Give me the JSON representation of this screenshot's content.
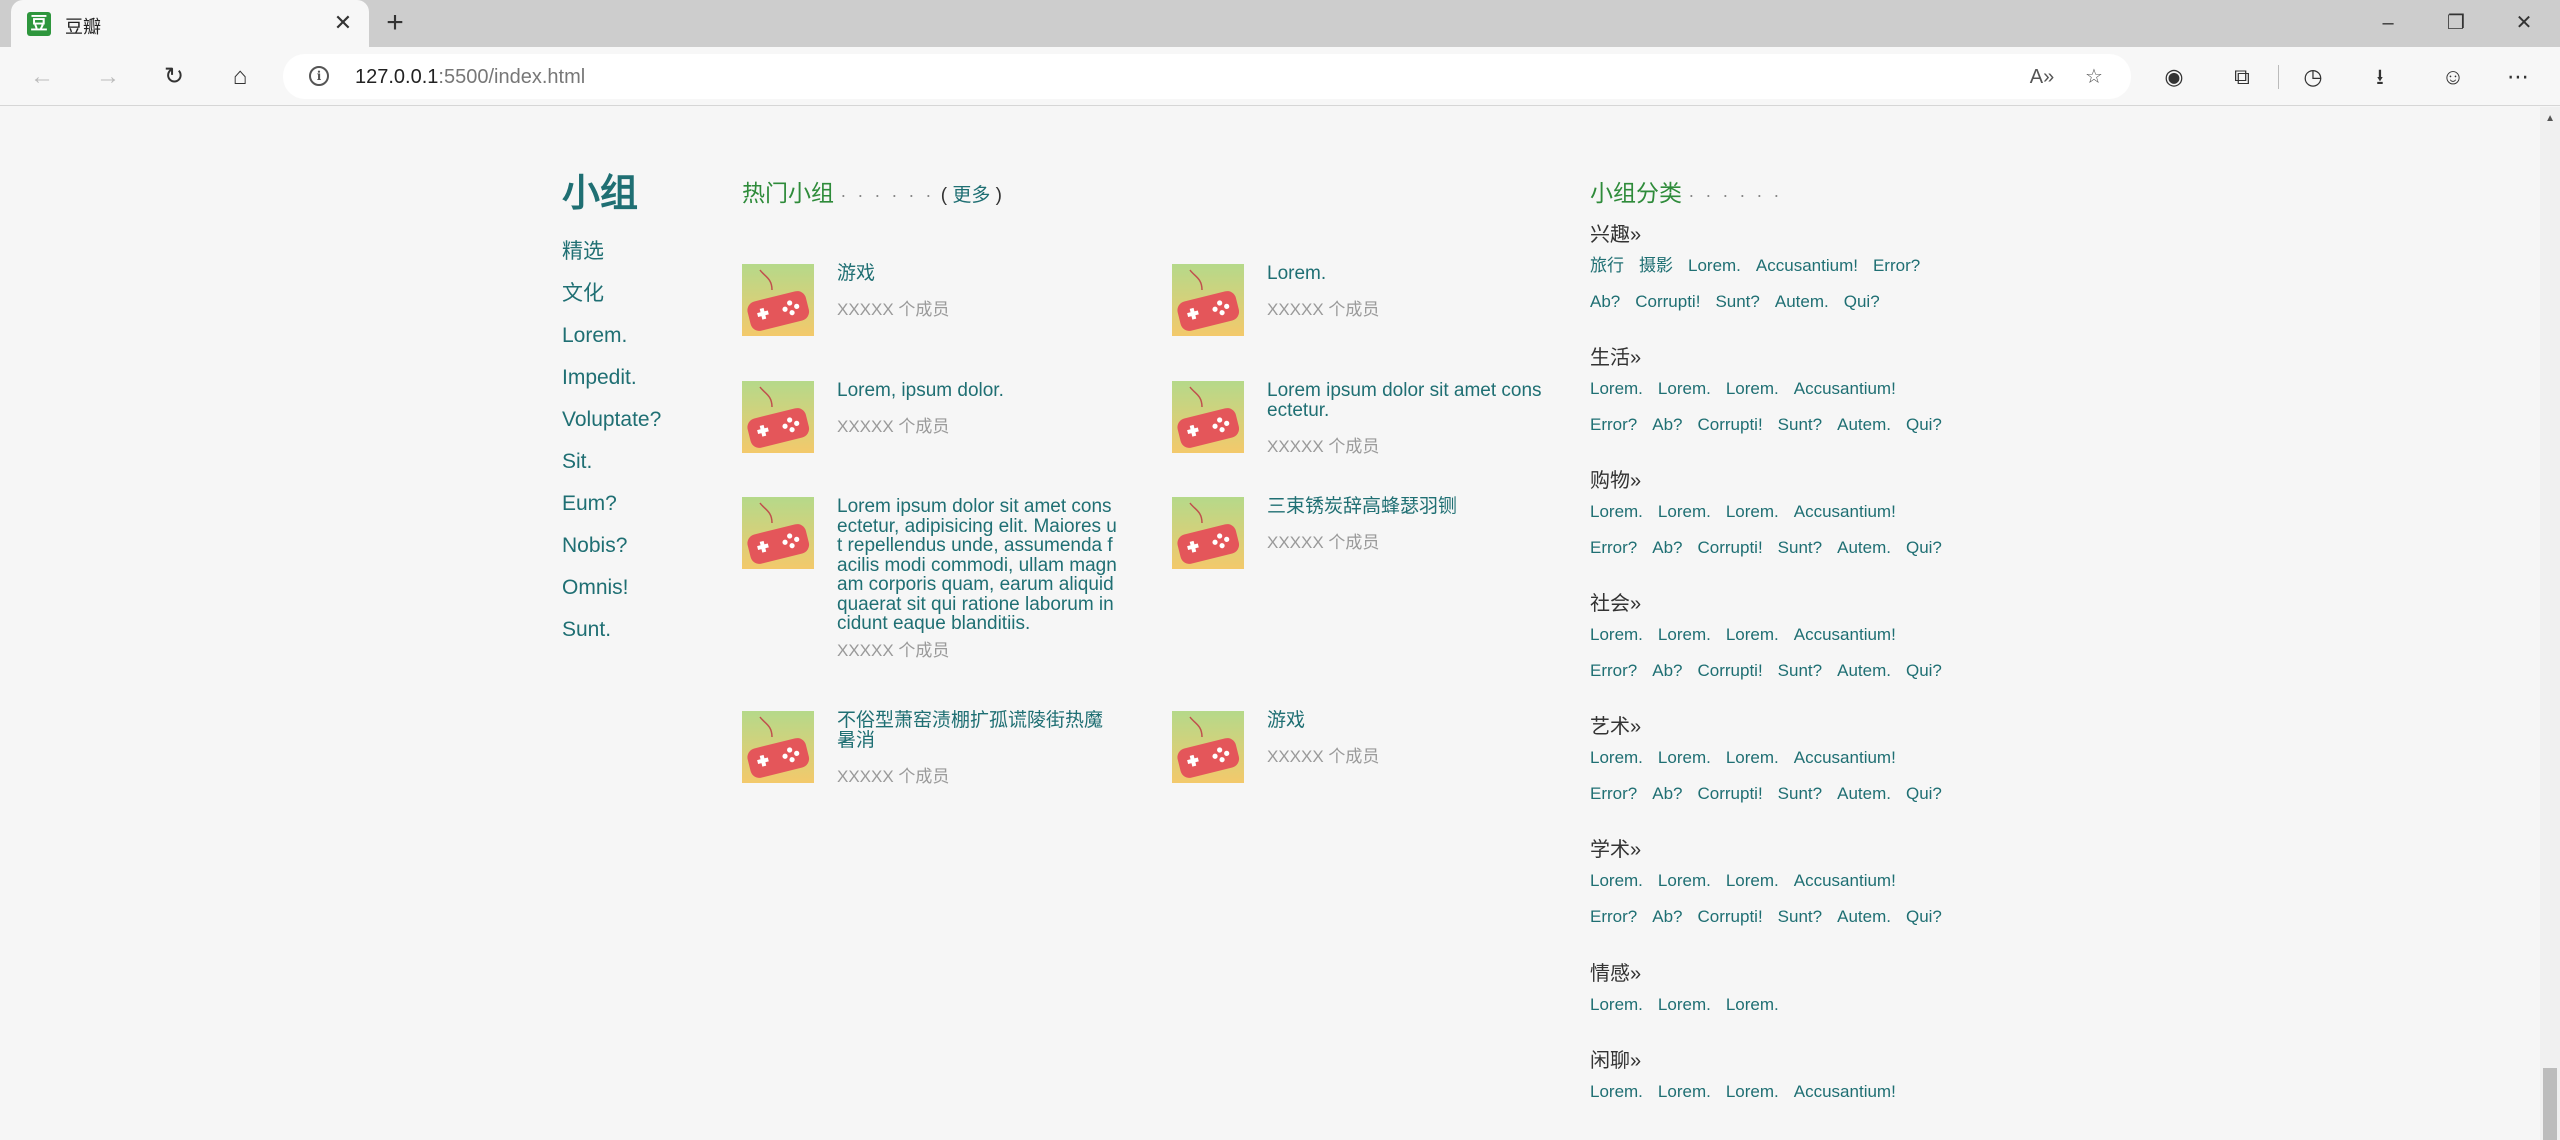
{
  "browser": {
    "tab_title": "豆瓣",
    "tab_icon": "douban-favicon",
    "favicon_char": "豆",
    "url_host": "127.0.0.1",
    "url_rest": ":5500/index.html"
  },
  "sidebar": {
    "title": "小组",
    "items": [
      "精选",
      "文化",
      "Lorem.",
      "Impedit.",
      "Voluptate?",
      "Sit.",
      "Eum?",
      "Nobis?",
      "Omnis!",
      "Sunt."
    ]
  },
  "hot": {
    "title": "热门小组",
    "dots": "· · · · · ·",
    "more_open": "(",
    "more_label": "更多",
    "more_close": ")",
    "groups": [
      {
        "name": "游戏",
        "members": "XXXXX 个成员"
      },
      {
        "name": "Lorem.",
        "members": "XXXXX 个成员"
      },
      {
        "name": "Lorem, ipsum dolor.",
        "members": "XXXXX 个成员"
      },
      {
        "name": "Lorem ipsum dolor sit amet consectetur.",
        "members": "XXXXX 个成员"
      },
      {
        "name": "Lorem ipsum dolor sit amet consectetur, adipisicing elit. Maiores ut repellendus unde, assumenda facilis modi commodi, ullam magnam corporis quam, earum aliquid quaerat sit qui ratione laborum incidunt eaque blanditiis.",
        "members": "XXXXX 个成员"
      },
      {
        "name": "三束锈炭辞高蜂瑟羽铡",
        "members": "XXXXX 个成员"
      },
      {
        "name": "不俗型萧窑渍棚扩孤谎陵街热魔暑消",
        "members": "XXXXX 个成员"
      },
      {
        "name": "游戏",
        "members": "XXXXX 个成员"
      }
    ]
  },
  "categories": {
    "title": "小组分类",
    "dots": "· · · · · ·",
    "blocks": [
      {
        "name": "兴趣»",
        "rows": [
          [
            "旅行",
            "摄影",
            "Lorem.",
            "Accusantium!",
            "Error?"
          ],
          [
            "Ab?",
            "Corrupti!",
            "Sunt?",
            "Autem.",
            "Qui?"
          ]
        ]
      },
      {
        "name": "生活»",
        "rows": [
          [
            "Lorem.",
            "Lorem.",
            "Lorem.",
            "Accusantium!"
          ],
          [
            "Error?",
            "Ab?",
            "Corrupti!",
            "Sunt?",
            "Autem.",
            "Qui?"
          ]
        ]
      },
      {
        "name": "购物»",
        "rows": [
          [
            "Lorem.",
            "Lorem.",
            "Lorem.",
            "Accusantium!"
          ],
          [
            "Error?",
            "Ab?",
            "Corrupti!",
            "Sunt?",
            "Autem.",
            "Qui?"
          ]
        ]
      },
      {
        "name": "社会»",
        "rows": [
          [
            "Lorem.",
            "Lorem.",
            "Lorem.",
            "Accusantium!"
          ],
          [
            "Error?",
            "Ab?",
            "Corrupti!",
            "Sunt?",
            "Autem.",
            "Qui?"
          ]
        ]
      },
      {
        "name": "艺术»",
        "rows": [
          [
            "Lorem.",
            "Lorem.",
            "Lorem.",
            "Accusantium!"
          ],
          [
            "Error?",
            "Ab?",
            "Corrupti!",
            "Sunt?",
            "Autem.",
            "Qui?"
          ]
        ]
      },
      {
        "name": "学术»",
        "rows": [
          [
            "Lorem.",
            "Lorem.",
            "Lorem.",
            "Accusantium!"
          ],
          [
            "Error?",
            "Ab?",
            "Corrupti!",
            "Sunt?",
            "Autem.",
            "Qui?"
          ]
        ]
      },
      {
        "name": "情感»",
        "rows": [
          [
            "Lorem.",
            "Lorem.",
            "Lorem."
          ]
        ]
      },
      {
        "name": "闲聊»",
        "rows": [
          [
            "Lorem.",
            "Lorem.",
            "Lorem.",
            "Accusantium!"
          ]
        ]
      }
    ]
  },
  "colors": {
    "link": "#1f6f73",
    "heading_green": "#2e8b3a",
    "muted": "#9a9a9a",
    "page_bg": "#f6f6f6"
  }
}
